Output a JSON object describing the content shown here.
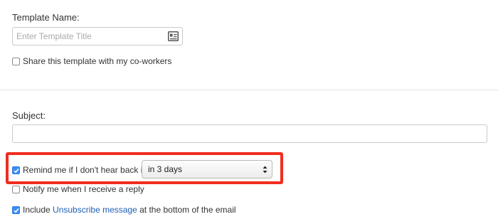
{
  "template_name": {
    "label": "Template Name:",
    "placeholder": "Enter Template Title",
    "icon": "contact-card-icon"
  },
  "share": {
    "label": "Share this template with my co-workers",
    "checked": false
  },
  "subject": {
    "label": "Subject:",
    "value": ""
  },
  "remind": {
    "label": "Remind me if I don't hear back in",
    "checked": true,
    "selected_option": "in 3 days",
    "highlight_color": "#f02d1f"
  },
  "notify": {
    "label": "Notify me when I receive a reply",
    "checked": false
  },
  "unsubscribe": {
    "prefix": "Include",
    "link_text": "Unsubscribe message",
    "suffix": "at the bottom of the email",
    "checked": true,
    "link_color": "#1f5fb5"
  },
  "colors": {
    "checkbox_checked": "#3b8ef3"
  }
}
